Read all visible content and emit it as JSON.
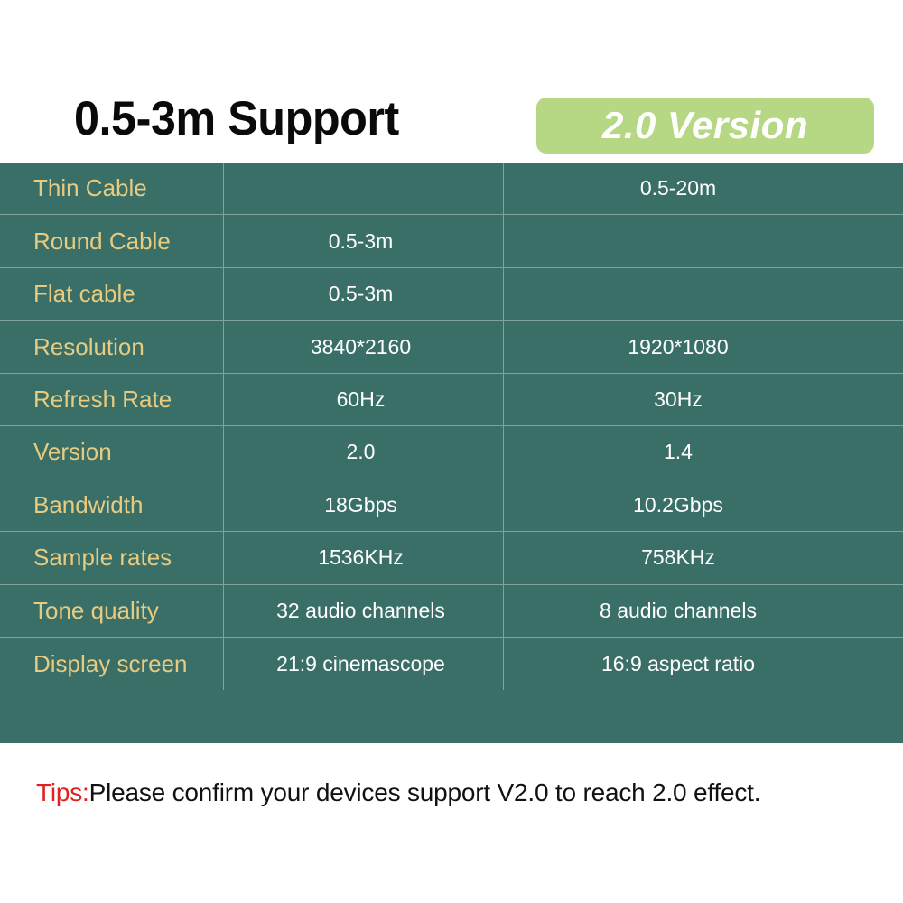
{
  "header": {
    "title": "0.5-3m Support",
    "badge_label": "2.0 Version",
    "badge_color": "#b6d884",
    "title_color": "#0a0a0a",
    "badge_text_color": "#ffffff"
  },
  "table": {
    "background_color": "#3a6f68",
    "label_color": "#e6cb80",
    "value_color": "#ffffff",
    "gridline_color": "#deeeea",
    "rows": [
      {
        "label": "Thin Cable",
        "v2": "",
        "v14": "0.5-20m"
      },
      {
        "label": "Round Cable",
        "v2": "0.5-3m",
        "v14": ""
      },
      {
        "label": "Flat cable",
        "v2": "0.5-3m",
        "v14": ""
      },
      {
        "label": "Resolution",
        "v2": "3840*2160",
        "v14": "1920*1080"
      },
      {
        "label": "Refresh Rate",
        "v2": "60Hz",
        "v14": "30Hz"
      },
      {
        "label": "Version",
        "v2": "2.0",
        "v14": "1.4"
      },
      {
        "label": "Bandwidth",
        "v2": "18Gbps",
        "v14": "10.2Gbps"
      },
      {
        "label": "Sample rates",
        "v2": "1536KHz",
        "v14": "758KHz"
      },
      {
        "label": "Tone quality",
        "v2": "32 audio channels",
        "v14": "8 audio channels"
      },
      {
        "label": "Display screen",
        "v2": "21:9 cinemascope",
        "v14": "16:9 aspect ratio"
      }
    ]
  },
  "footer": {
    "tips_prefix": "Tips:",
    "tips_text": "Please confirm your devices support V2.0 to reach 2.0 effect.",
    "tips_prefix_color": "#e12020",
    "tips_text_color": "#111111"
  }
}
